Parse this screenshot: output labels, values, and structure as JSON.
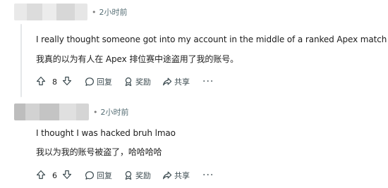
{
  "comments": [
    {
      "time": "2小时前",
      "text_en": "I really thought someone got into my account in the middle of a ranked Apex match .-.",
      "text_zh": "我真的以为有人在 Apex 排位赛中途盗用了我的账号。",
      "score": "8",
      "reply_label": "回复",
      "award_label": "奖励",
      "share_label": "共享",
      "more_label": "···"
    },
    {
      "time": "2小时前",
      "text_en": "I thought I was hacked bruh lmao",
      "text_zh": "我以为我的账号被盗了，哈哈哈哈",
      "score": "6",
      "reply_label": "回复",
      "award_label": "奖励",
      "share_label": "共享",
      "more_label": "···"
    }
  ],
  "colors": {
    "text": "#1c1c1c",
    "meta": "#576f76",
    "thread_line": "#e5e7e9"
  },
  "icons": [
    "upvote-icon",
    "downvote-icon",
    "reply-icon",
    "award-icon",
    "share-icon",
    "more-icon"
  ]
}
